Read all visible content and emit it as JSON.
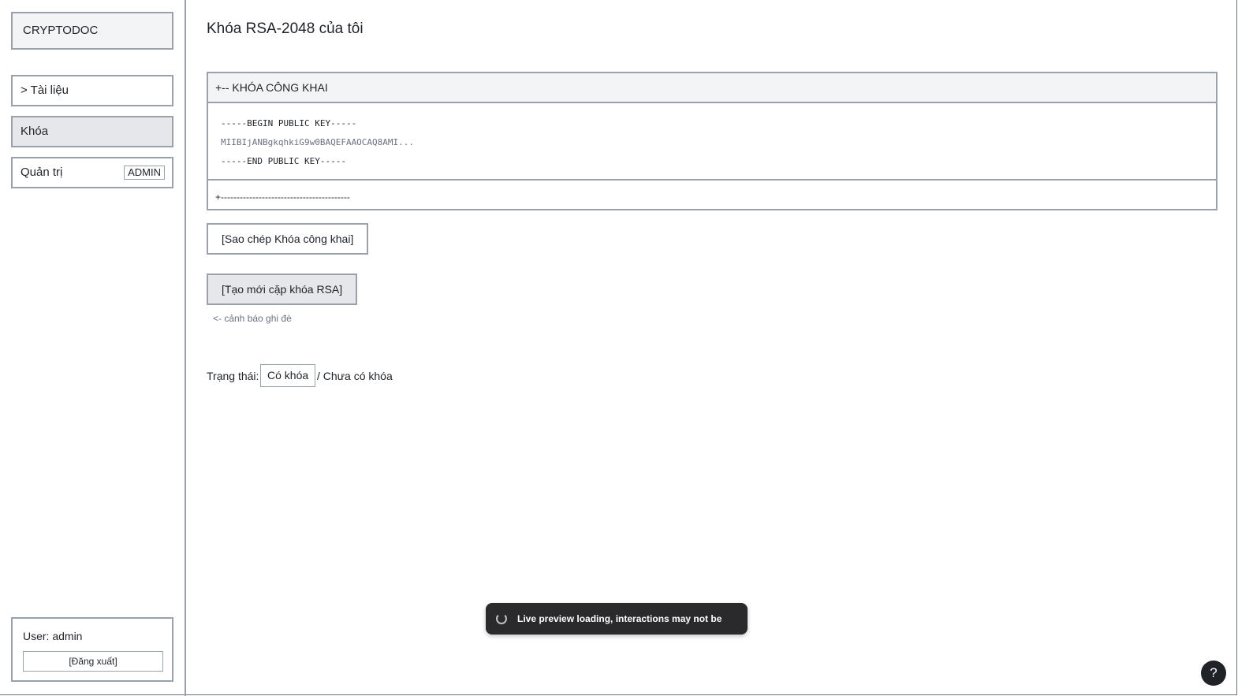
{
  "sidebar": {
    "brand": "CRYPTODOC",
    "items": [
      {
        "label": "> Tài liệu"
      },
      {
        "label": "Khóa"
      },
      {
        "label": "Quản trị",
        "badge": "ADMIN"
      }
    ],
    "user": {
      "label": "User: admin",
      "logout_label": "[Đăng xuất]"
    }
  },
  "main": {
    "title": "Khóa RSA-2048 của tôi",
    "public_key_panel": {
      "header": "+-- KHÓA CÔNG KHAI",
      "lines": [
        "-----BEGIN PUBLIC KEY-----",
        "MIIBIjANBgkqhkiG9w0BAQEFAAOCAQ8AMI...",
        "-----END PUBLIC KEY-----"
      ],
      "footer": "+-----------------------------------------"
    },
    "copy_button": "[Sao chép Khóa công khai]",
    "regen_button": "[Tạo mới cặp khóa RSA]",
    "regen_warning": "<- cảnh báo ghi đè",
    "status": {
      "label": "Trạng thái:",
      "active": "Có khóa",
      "inactive": "/ Chưa có khóa"
    }
  },
  "toast": {
    "text": "Live preview loading, interactions may not be saved",
    "icon": "spinner-icon"
  },
  "help": {
    "label": "?",
    "icon": "help-icon"
  }
}
